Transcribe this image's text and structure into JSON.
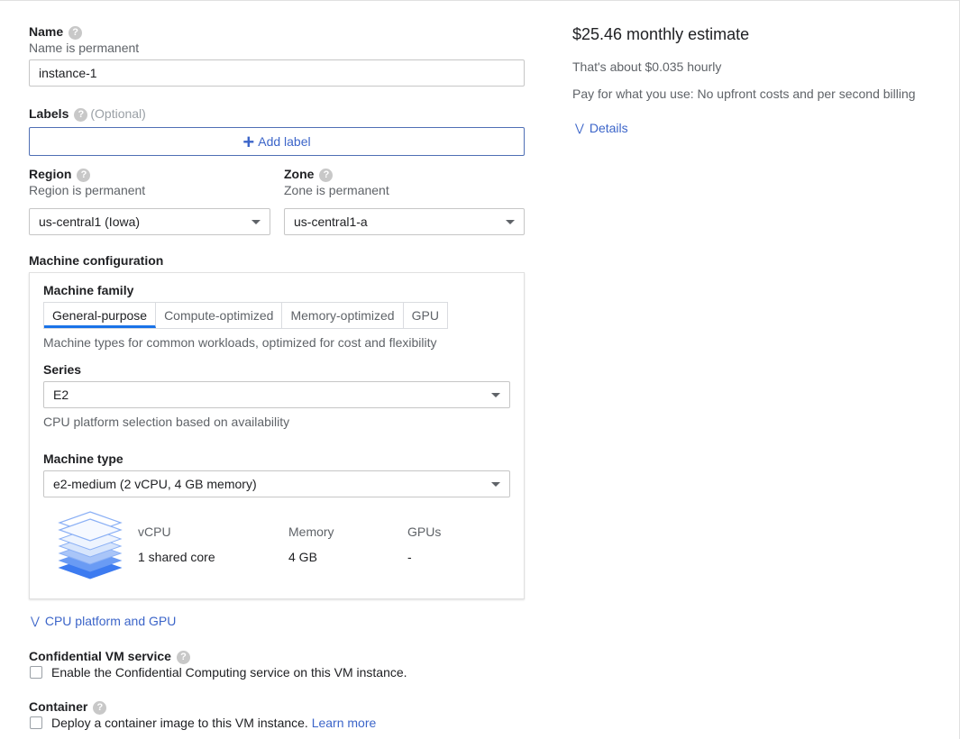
{
  "name": {
    "label": "Name",
    "hint": "Name is permanent",
    "value": "instance-1"
  },
  "labels": {
    "label": "Labels",
    "optional": "(Optional)",
    "add_button": "Add label"
  },
  "region": {
    "label": "Region",
    "hint": "Region is permanent",
    "value": "us-central1 (Iowa)"
  },
  "zone": {
    "label": "Zone",
    "hint": "Zone is permanent",
    "value": "us-central1-a"
  },
  "machine_config": {
    "title": "Machine configuration",
    "family_label": "Machine family",
    "tabs": [
      "General-purpose",
      "Compute-optimized",
      "Memory-optimized",
      "GPU"
    ],
    "active_tab": "General-purpose",
    "family_desc": "Machine types for common workloads, optimized for cost and flexibility",
    "series_label": "Series",
    "series_value": "E2",
    "series_desc": "CPU platform selection based on availability",
    "type_label": "Machine type",
    "type_value": "e2-medium (2 vCPU, 4 GB memory)",
    "specs": {
      "vcpu_header": "vCPU",
      "vcpu_value": "1 shared core",
      "memory_header": "Memory",
      "memory_value": "4 GB",
      "gpus_header": "GPUs",
      "gpus_value": "-"
    }
  },
  "cpu_platform_link": "CPU platform and GPU",
  "confidential": {
    "label": "Confidential VM service",
    "checkbox_text": "Enable the Confidential Computing service on this VM instance."
  },
  "container": {
    "label": "Container",
    "checkbox_text": "Deploy a container image to this VM instance.",
    "learn_more": "Learn more"
  },
  "estimate": {
    "title": "$25.46 monthly estimate",
    "hourly": "That's about $0.035 hourly",
    "billing": "Pay for what you use: No upfront costs and per second billing",
    "details": "Details"
  },
  "colors": {
    "accent": "#1a73e8",
    "link": "#3c65c9"
  },
  "icons": {
    "help": "help-icon",
    "add": "plus-icon",
    "expand": "chevron-down-icon",
    "machine": "layers-icon"
  }
}
